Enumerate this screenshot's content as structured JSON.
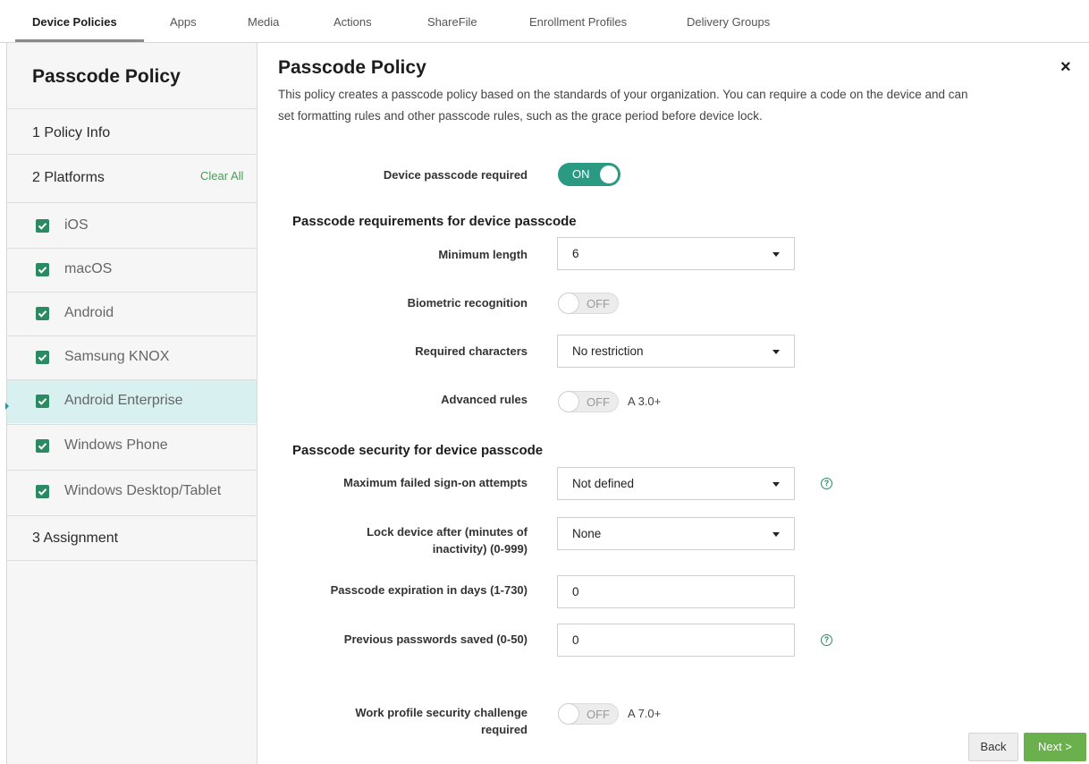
{
  "tabs": [
    {
      "label": "Device Policies",
      "active": true
    },
    {
      "label": "Apps"
    },
    {
      "label": "Media"
    },
    {
      "label": "Actions"
    },
    {
      "label": "ShareFile"
    },
    {
      "label": "Enrollment Profiles"
    },
    {
      "label": "Delivery Groups"
    }
  ],
  "sidebar": {
    "title": "Passcode Policy",
    "step1": "1  Policy Info",
    "step2": "2  Platforms",
    "clear_all": "Clear All",
    "platforms": [
      {
        "label": "iOS",
        "checked": true
      },
      {
        "label": "macOS",
        "checked": true
      },
      {
        "label": "Android",
        "checked": true
      },
      {
        "label": "Samsung KNOX",
        "checked": true
      },
      {
        "label": "Android Enterprise",
        "checked": true,
        "selected": true
      },
      {
        "label": "Windows Phone",
        "checked": true
      },
      {
        "label": "Windows Desktop/Tablet",
        "checked": true
      }
    ],
    "step3": "3  Assignment"
  },
  "main": {
    "title": "Passcode Policy",
    "description": "This policy creates a passcode policy based on the standards of your organization. You can require a code on the device and can set formatting rules and other passcode rules, such as the grace period before device lock.",
    "close": "×",
    "device_passcode_required": {
      "label": "Device passcode required",
      "value": "ON"
    },
    "section1_title": "Passcode requirements for device passcode",
    "minimum_length": {
      "label": "Minimum length",
      "value": "6"
    },
    "biometric_recognition": {
      "label": "Biometric recognition",
      "value": "OFF"
    },
    "required_characters": {
      "label": "Required characters",
      "value": "No restriction"
    },
    "advanced_rules": {
      "label": "Advanced rules",
      "value": "OFF",
      "platform": "A 3.0+"
    },
    "section2_title": "Passcode security for device passcode",
    "max_failed_attempts": {
      "label": "Maximum failed sign-on attempts",
      "value": "Not defined"
    },
    "lock_device_after": {
      "label_line1": "Lock device after (minutes of",
      "label_line2": "inactivity) (0-999)",
      "value": "None"
    },
    "passcode_expiration": {
      "label": "Passcode expiration in days (1-730)",
      "value": "0"
    },
    "previous_passwords": {
      "label": "Previous passwords saved (0-50)",
      "value": "0"
    },
    "work_profile_challenge": {
      "label_line1": "Work profile security challenge",
      "label_line2": "required",
      "value": "OFF",
      "platform": "A 7.0+"
    },
    "help_glyph": "?"
  },
  "footer": {
    "back_label": "Back",
    "next_label": "Next >"
  },
  "colors": {
    "accent_green": "#2b8a62",
    "toggle_on": "#2b9a82",
    "next_button": "#6ab04c",
    "selected_row": "#d8f0ef"
  }
}
